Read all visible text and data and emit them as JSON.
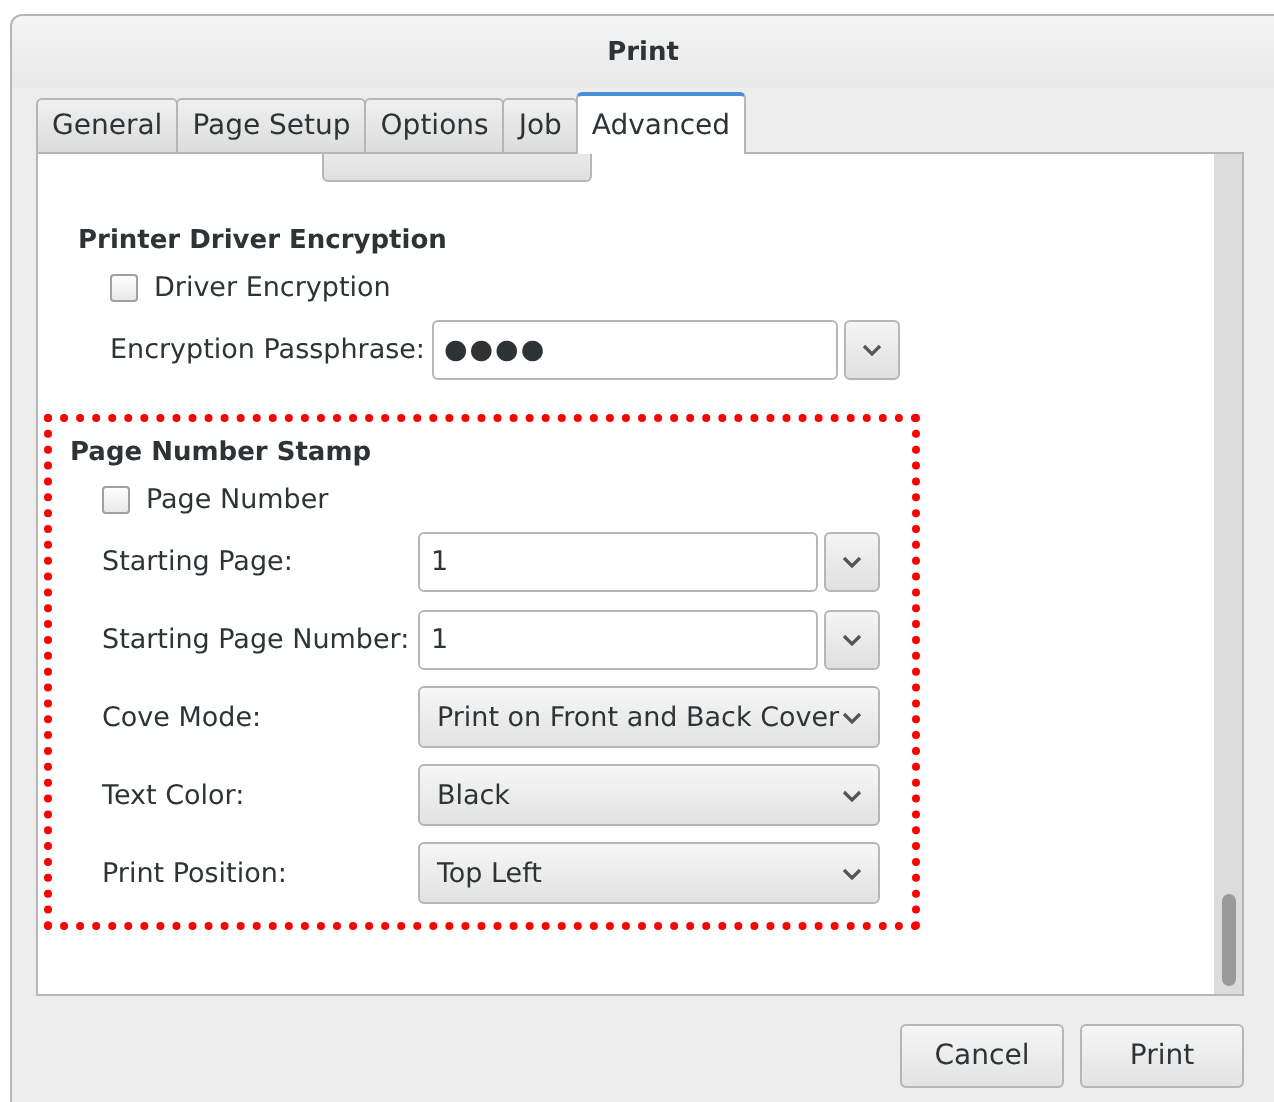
{
  "window": {
    "title": "Print"
  },
  "tabs": [
    {
      "label": "General",
      "selected": false
    },
    {
      "label": "Page Setup",
      "selected": false
    },
    {
      "label": "Options",
      "selected": false
    },
    {
      "label": "Job",
      "selected": false
    },
    {
      "label": "Advanced",
      "selected": true
    }
  ],
  "sections": [
    {
      "heading": "Printer Driver Encryption",
      "highlighted": false,
      "checkbox": {
        "label": "Driver Encryption",
        "checked": false
      },
      "rows": [
        {
          "kind": "entry-combo",
          "label": "Encryption Passphrase:",
          "value": "●●●●"
        }
      ]
    },
    {
      "heading": "Page Number Stamp",
      "highlighted": true,
      "checkbox": {
        "label": "Page Number",
        "checked": false
      },
      "rows": [
        {
          "kind": "entry-combo",
          "label": "Starting Page:",
          "value": "1"
        },
        {
          "kind": "entry-combo",
          "label": "Starting Page Number:",
          "value": "1"
        },
        {
          "kind": "combo",
          "label": "Cove Mode:",
          "value": "Print on Front and Back Cover"
        },
        {
          "kind": "combo",
          "label": "Text Color:",
          "value": "Black"
        },
        {
          "kind": "combo",
          "label": "Print Position:",
          "value": "Top Left"
        }
      ]
    }
  ],
  "buttons": [
    "Cancel",
    "Print"
  ]
}
